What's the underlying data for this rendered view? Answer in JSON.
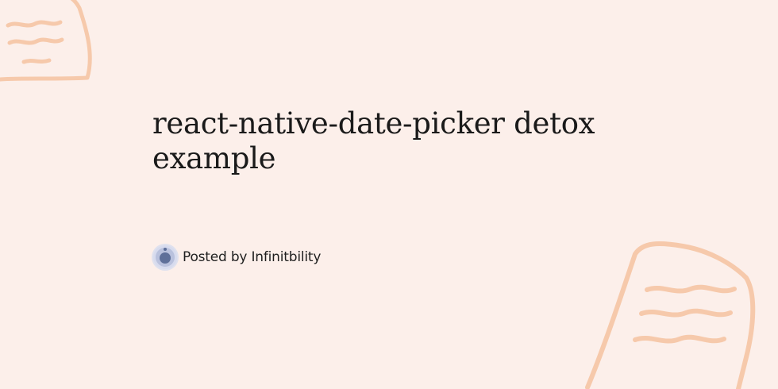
{
  "post": {
    "title": "react-native-date-picker detox example",
    "author_line": "Posted by Infinitbility"
  },
  "icons": {
    "avatar": "author-avatar-icon",
    "decoration_top": "scribble-decoration-icon",
    "decoration_bottom": "scribble-decoration-icon"
  },
  "colors": {
    "background": "#fcefea",
    "decoration": "#f6c9ab",
    "title_text": "#1a1a1a",
    "avatar_ring": "#dfe1ee",
    "avatar_core": "#5e6f99"
  }
}
